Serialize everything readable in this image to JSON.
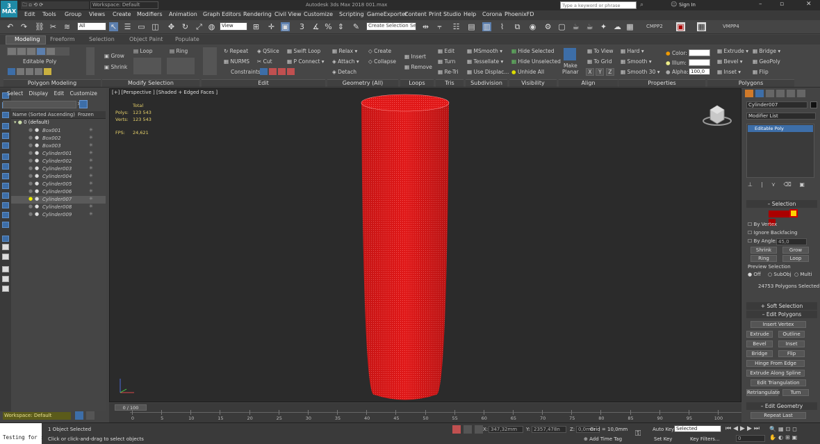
{
  "app": {
    "title": "Autodesk 3ds Max 2018    001.max",
    "logo_label": "3\nMAX",
    "workspace_label": "Workspace: Default",
    "search_placeholder": "Type a keyword or phrase",
    "sign_in": "Sign In"
  },
  "menu": [
    "Edit",
    "Tools",
    "Group",
    "Views",
    "Create",
    "Modifiers",
    "Animation",
    "Graph Editors",
    "Rendering",
    "Civil View",
    "Customize",
    "Scripting",
    "GameExporter",
    "Content",
    "Print Studio",
    "Help",
    "Corona",
    "PhoenixFD"
  ],
  "toolbar": {
    "filter_select": "All",
    "refcoord_select": "View",
    "selection_set": "Create Selection Se",
    "plugin_a": "CMPP2",
    "plugin_b": "VMPP4"
  },
  "ribbon_tabs": [
    "Modeling",
    "Freeform",
    "Selection",
    "Object Paint",
    "Populate"
  ],
  "ribbon": {
    "editable_poly": "Editable Poly",
    "grow": "Grow",
    "shrink": "Shrink",
    "loop": "Loop",
    "ring": "Ring",
    "repeat": "Repeat",
    "qslice": "QSlice",
    "swift_loop": "Swift Loop",
    "nurms": "NURMS",
    "cut": "Cut",
    "p_connect": "P Connect",
    "constraints": "Constraints:",
    "relax": "Relax",
    "create": "Create",
    "attach": "Attach",
    "collapse": "Collapse",
    "detach": "Detach",
    "insert": "Insert",
    "remove": "Remove",
    "edit": "Edit",
    "turn": "Turn",
    "retri": "Re-Tri",
    "msmooth": "MSmooth",
    "tessellate": "Tessellate",
    "use_displac": "Use Displac...",
    "hide_selected": "Hide Selected",
    "hide_unselected": "Hide Unselected",
    "unhide_all": "Unhide All",
    "make_planar": "Make\nPlanar",
    "to_view": "To View",
    "to_grid": "To Grid",
    "xyz": [
      "X",
      "Y",
      "Z"
    ],
    "hard": "Hard",
    "smooth": "Smooth",
    "smooth30": "Smooth 30",
    "color": "Color:",
    "illum": "Illum:",
    "alpha": "Alpha:",
    "alpha_value": "100,0",
    "extrude": "Extrude",
    "bevel": "Bevel",
    "inset": "Inset",
    "bridge": "Bridge",
    "geopoly": "GeoPoly",
    "flip": "Flip"
  },
  "ribbon_sections": [
    {
      "label": "Polygon Modeling"
    },
    {
      "label": "Modify Selection"
    },
    {
      "label": "Edit"
    },
    {
      "label": "Geometry (All)"
    },
    {
      "label": "Loops"
    },
    {
      "label": "Tris"
    },
    {
      "label": "Subdivision"
    },
    {
      "label": "Visibility"
    },
    {
      "label": "Align"
    },
    {
      "label": "Properties"
    },
    {
      "label": "Polygons"
    }
  ],
  "scene_explorer": {
    "tabs": [
      "Select",
      "Display",
      "Edit",
      "Customize"
    ],
    "col_name": "Name (Sorted Ascending)",
    "col_frozen": "Frozen",
    "layer": "0 (default)",
    "objects": [
      "Box001",
      "Box002",
      "Box003",
      "Cylinder001",
      "Cylinder002",
      "Cylinder003",
      "Cylinder004",
      "Cylinder005",
      "Cylinder006",
      "Cylinder007",
      "Cylinder008",
      "Cylinder009"
    ],
    "selected": "Cylinder007",
    "workspace": "Workspace: Default"
  },
  "viewport": {
    "label": "[+] [Perspective ] [Shaded + Edged Faces ]",
    "stats_total": "Total",
    "polys_label": "Polys:",
    "polys_value": "123 543",
    "verts_label": "Verts:",
    "verts_value": "123 543",
    "fps_label": "FPS:",
    "fps_value": "24,621",
    "object_color": "#e01818"
  },
  "command_panel": {
    "object_name": "Cylinder007",
    "modifier_list": "Modifier List",
    "stack_item": "Editable Poly",
    "selection_rollout": "Selection",
    "by_vertex": "By Vertex",
    "ignore_backfacing": "Ignore Backfacing",
    "by_angle": "By Angle:",
    "by_angle_value": "45,0",
    "shrink": "Shrink",
    "grow": "Grow",
    "ring": "Ring",
    "loop": "Loop",
    "preview_selection": "Preview Selection",
    "off": "Off",
    "subobj": "SubObj",
    "multi": "Multi",
    "selected_count": "24753 Polygons Selected",
    "soft_selection": "Soft Selection",
    "edit_polygons": "Edit Polygons",
    "insert_vertex": "Insert Vertex",
    "extrude": "Extrude",
    "outline": "Outline",
    "bevel": "Bevel",
    "inset": "Inset",
    "bridge": "Bridge",
    "flip": "Flip",
    "hinge_from_edge": "Hinge From Edge",
    "extrude_along_spline": "Extrude Along Spline",
    "edit_triangulation": "Edit Triangulation",
    "retriangulate": "Retriangulate",
    "turn": "Turn",
    "edit_geometry": "Edit Geometry",
    "repeat_last": "Repeat Last"
  },
  "timeline": {
    "frame": "0 / 100",
    "ticks": [
      "0",
      "5",
      "10",
      "15",
      "20",
      "25",
      "30",
      "35",
      "40",
      "45",
      "50",
      "55",
      "60",
      "65",
      "70",
      "75",
      "80",
      "85",
      "90",
      "95",
      "100"
    ]
  },
  "status": {
    "objects_selected": "1 Object Selected",
    "prompt": "Click or click-and-drag to select objects",
    "maxscript": "Testing for :",
    "x_label": "X:",
    "x_value": "347,32mm",
    "y_label": "Y:",
    "y_value": "2357,478n",
    "z_label": "Z:",
    "z_value": "0,0mm",
    "grid": "Grid = 10,0mm",
    "add_time_tag": "Add Time Tag",
    "auto_key": "Auto Key",
    "set_key": "Set Key",
    "key_mode": "Selected",
    "key_filters": "Key Filters...",
    "frame_field": "0"
  }
}
